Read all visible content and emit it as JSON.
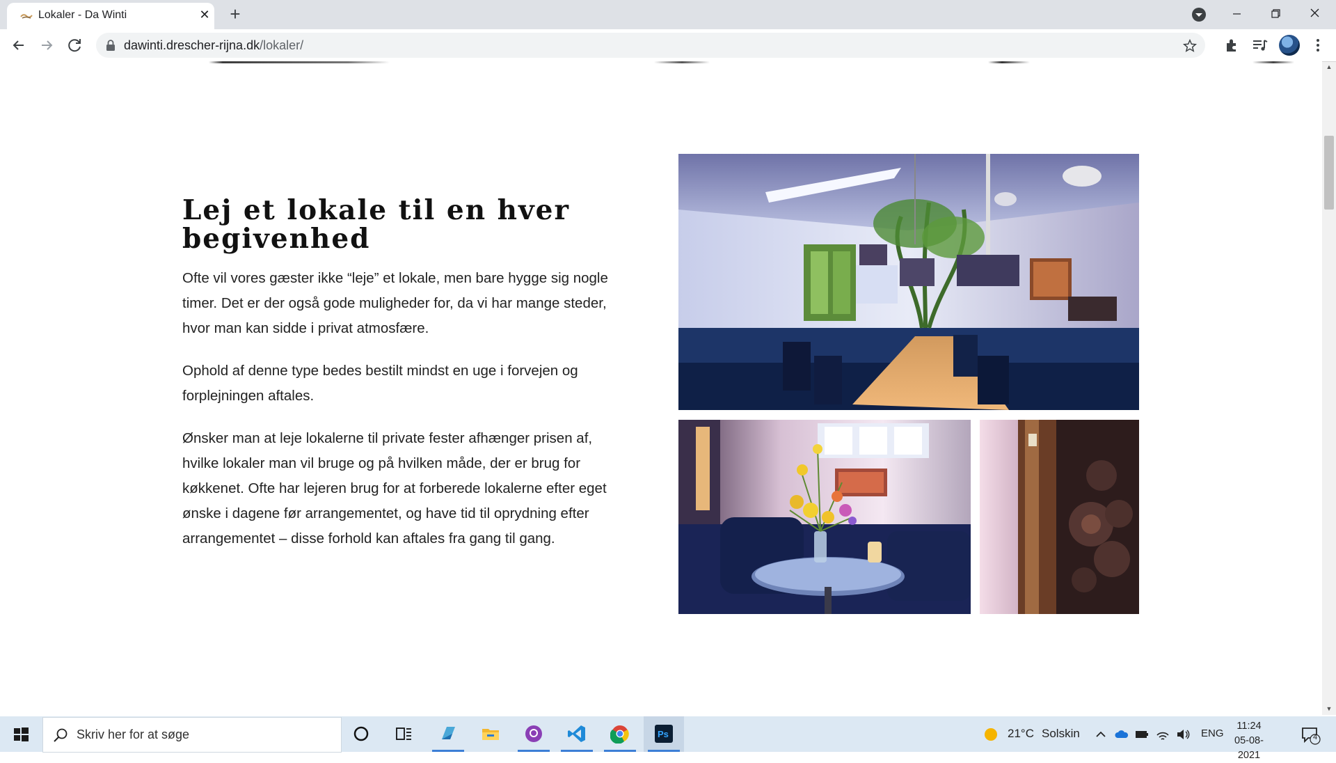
{
  "browser": {
    "tab_title": "Lokaler - Da Winti",
    "url_domain": "dawinti.drescher-rijna.dk",
    "url_path": "/lokaler/"
  },
  "page": {
    "heading": "Lej et lokale til en hver begivenhed",
    "paragraphs": [
      "Ofte vil vores gæster ikke “leje” et lokale, men bare hygge sig nogle timer. Det er der også gode muligheder for, da vi har mange steder, hvor man kan sidde i privat atmosfære.",
      "Ophold af denne type bedes bestilt mindst en uge i forvejen og forplejningen aftales.",
      " Ønsker man at leje lokalerne til private fester afhænger prisen af, hvilke lokaler man vil bruge og på hvilken måde, der er brug for køkkenet. Ofte har lejeren brug for at forberede lokalerne efter eget ønske i dagene før arrangementet, og have tid til oprydning efter arrangementet – disse forhold kan aftales fra gang til gang."
    ]
  },
  "taskbar": {
    "search_placeholder": "Skriv her for at søge",
    "weather_temp": "21°C",
    "weather_text": "Solskin",
    "language": "ENG",
    "time": "11:24",
    "date": "05-08-2021",
    "notification_count": "4",
    "apps": [
      "cortana-icon",
      "task-view-icon",
      "azure-data-studio-icon",
      "file-explorer-icon",
      "github-desktop-icon",
      "vscode-icon",
      "chrome-icon",
      "photoshop-icon"
    ]
  },
  "colors": {
    "taskbar_bg": "#dce8f3",
    "taskbar_accent": "#3c7fd6",
    "chrome_tabstrip": "#dee1e6"
  }
}
